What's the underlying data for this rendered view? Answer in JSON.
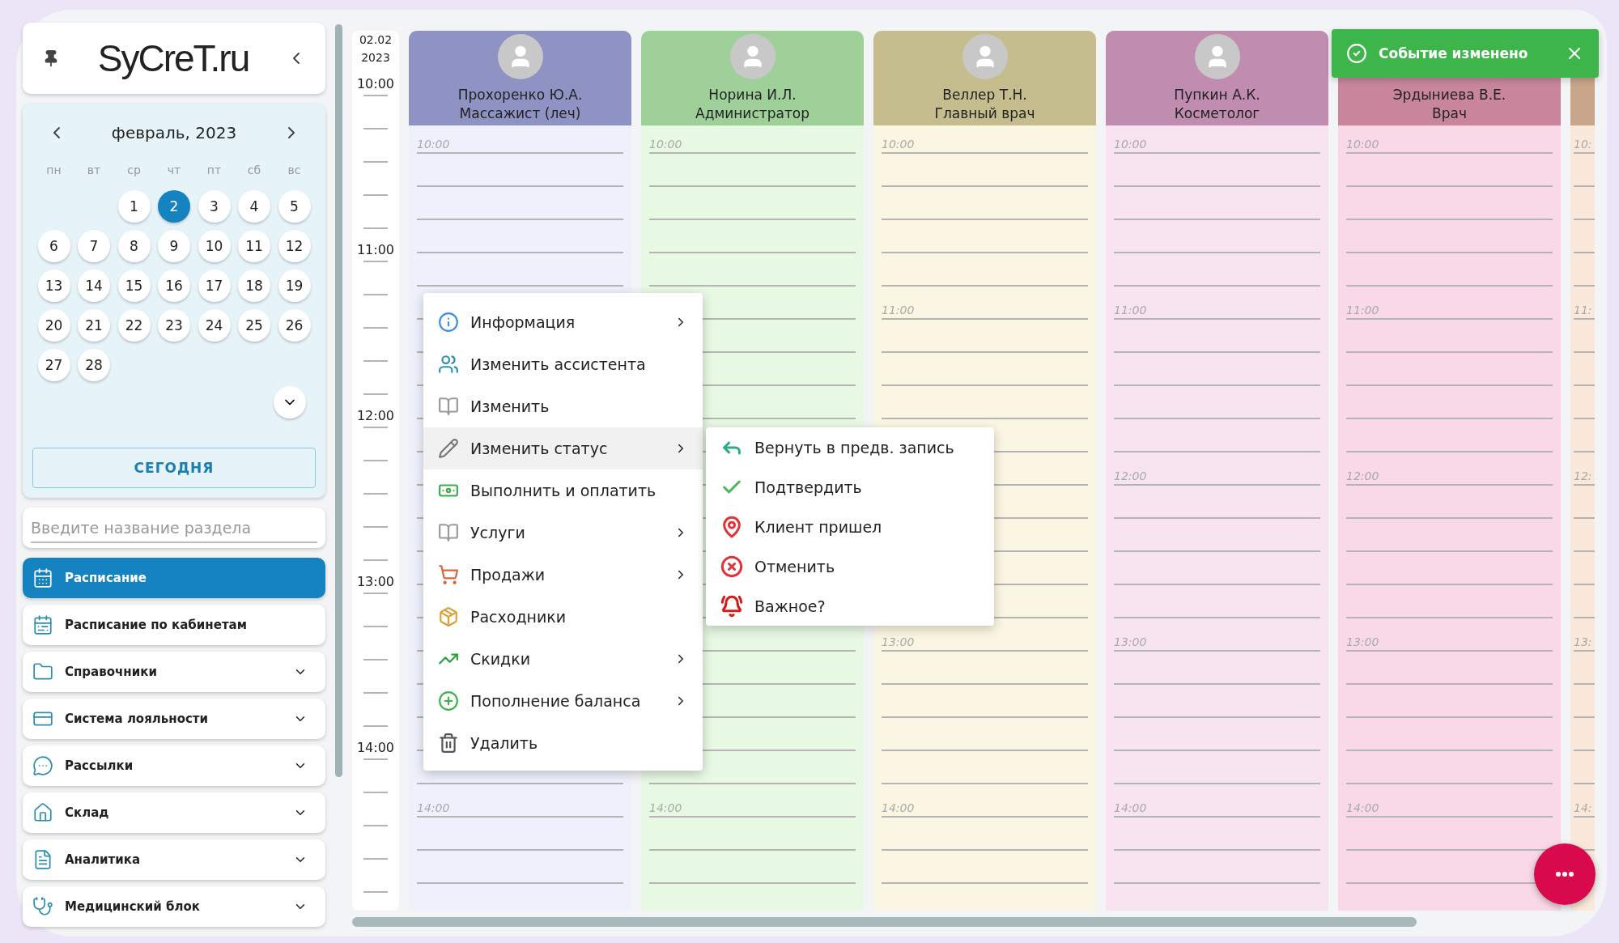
{
  "sidebar": {
    "logo": "SyCreT.ru",
    "calendar": {
      "month": "февраль, 2023",
      "weekdays": [
        "пн",
        "вт",
        "ср",
        "чт",
        "пт",
        "сб",
        "вс"
      ],
      "weeks": [
        {
          "kind": "leading",
          "days": [
            {
              "label": "1",
              "selected": false
            },
            {
              "label": "2",
              "selected": true
            },
            {
              "label": "3",
              "selected": false
            },
            {
              "label": "4",
              "selected": false
            },
            {
              "label": "5",
              "selected": false
            }
          ]
        },
        {
          "kind": "full",
          "days": [
            {
              "label": "6",
              "selected": false
            },
            {
              "label": "7",
              "selected": false
            },
            {
              "label": "8",
              "selected": false
            },
            {
              "label": "9",
              "selected": false
            },
            {
              "label": "10",
              "selected": false
            },
            {
              "label": "11",
              "selected": false
            },
            {
              "label": "12",
              "selected": false
            }
          ]
        },
        {
          "kind": "full",
          "days": [
            {
              "label": "13",
              "selected": false
            },
            {
              "label": "14",
              "selected": false
            },
            {
              "label": "15",
              "selected": false
            },
            {
              "label": "16",
              "selected": false
            },
            {
              "label": "17",
              "selected": false
            },
            {
              "label": "18",
              "selected": false
            },
            {
              "label": "19",
              "selected": false
            }
          ]
        },
        {
          "kind": "full",
          "days": [
            {
              "label": "20",
              "selected": false
            },
            {
              "label": "21",
              "selected": false
            },
            {
              "label": "22",
              "selected": false
            },
            {
              "label": "23",
              "selected": false
            },
            {
              "label": "24",
              "selected": false
            },
            {
              "label": "25",
              "selected": false
            },
            {
              "label": "26",
              "selected": false
            }
          ]
        },
        {
          "kind": "full",
          "days": [
            {
              "label": "27",
              "selected": false
            },
            {
              "label": "28",
              "selected": false
            }
          ]
        }
      ],
      "today_button": "СЕГОДНЯ"
    },
    "search": {
      "placeholder": "Введите название раздела"
    },
    "nav": [
      {
        "label": "Расписание",
        "selected": true,
        "expandable": false
      },
      {
        "label": "Расписание по кабинетам",
        "selected": false,
        "expandable": false
      },
      {
        "label": "Справочники",
        "selected": false,
        "expandable": true
      },
      {
        "label": "Система лояльности",
        "selected": false,
        "expandable": true
      },
      {
        "label": "Рассылки",
        "selected": false,
        "expandable": true
      },
      {
        "label": "Склад",
        "selected": false,
        "expandable": true
      },
      {
        "label": "Аналитика",
        "selected": false,
        "expandable": true
      },
      {
        "label": "Медицинский блок",
        "selected": false,
        "expandable": true
      }
    ]
  },
  "schedule": {
    "date": "02.02",
    "year": "2023",
    "hours": [
      "10:00",
      "11:00",
      "12:00",
      "13:00",
      "14:00"
    ],
    "columns": [
      {
        "kind": "staff",
        "avatar": true,
        "name": "Прохоренко Ю.А.",
        "role": "Массажист (леч)",
        "color": "#8e93c4",
        "blocks": [
          {
            "kind": "labeled",
            "label": "10:00"
          },
          {
            "kind": "blank"
          },
          {
            "kind": "blank"
          },
          {
            "kind": "blank"
          },
          {
            "kind": "labeled",
            "label": "14:00"
          }
        ]
      },
      {
        "kind": "staff",
        "avatar": true,
        "name": "Норина И.Л.",
        "role": "Администратор",
        "color": "#9fd09a",
        "blocks": [
          {
            "kind": "labeled",
            "label": "10:00"
          },
          {
            "kind": "blank"
          },
          {
            "kind": "blank"
          },
          {
            "kind": "blank"
          },
          {
            "kind": "labeled",
            "label": "14:00"
          }
        ]
      },
      {
        "kind": "staff",
        "avatar": true,
        "name": "Веллер Т.Н.",
        "role": "Главный врач",
        "color": "#c5bd8e",
        "blocks": [
          {
            "kind": "labeled",
            "label": "10:00"
          },
          {
            "kind": "labeled",
            "label": "11:00"
          },
          {
            "kind": "blank"
          },
          {
            "kind": "labeled",
            "label": "13:00"
          },
          {
            "kind": "labeled",
            "label": "14:00"
          }
        ]
      },
      {
        "kind": "staff",
        "avatar": true,
        "name": "Пупкин А.К.",
        "role": "Косметолог",
        "color": "#c08db0",
        "blocks": [
          {
            "kind": "labeled",
            "label": "10:00"
          },
          {
            "kind": "labeled",
            "label": "11:00"
          },
          {
            "kind": "labeled",
            "label": "12:00"
          },
          {
            "kind": "labeled",
            "label": "13:00"
          },
          {
            "kind": "labeled",
            "label": "14:00"
          }
        ]
      },
      {
        "kind": "staff",
        "avatar": false,
        "name": "Эрдыниева В.Е.",
        "role": "Врач",
        "color": "#c9859c",
        "blocks": [
          {
            "kind": "labeled",
            "label": "10:00"
          },
          {
            "kind": "labeled",
            "label": "11:00"
          },
          {
            "kind": "labeled",
            "label": "12:00"
          },
          {
            "kind": "labeled",
            "label": "13:00"
          },
          {
            "kind": "labeled",
            "label": "14:00"
          }
        ]
      },
      {
        "kind": "partial",
        "color": "#c9a58a",
        "blocks": [
          {
            "kind": "labeled",
            "label": "10:"
          },
          {
            "kind": "labeled",
            "label": "11:"
          },
          {
            "kind": "labeled",
            "label": "12:"
          },
          {
            "kind": "labeled",
            "label": "13:"
          },
          {
            "kind": "labeled",
            "label": "14:"
          }
        ]
      }
    ]
  },
  "context_menu": [
    {
      "label": "Информация",
      "submenu": true,
      "selected": false
    },
    {
      "label": "Изменить ассистента",
      "submenu": false,
      "selected": false
    },
    {
      "label": "Изменить",
      "submenu": false,
      "selected": false
    },
    {
      "label": "Изменить статус",
      "submenu": true,
      "selected": true
    },
    {
      "label": "Выполнить и оплатить",
      "submenu": false,
      "selected": false
    },
    {
      "label": "Услуги",
      "submenu": true,
      "selected": false
    },
    {
      "label": "Продажи",
      "submenu": true,
      "selected": false
    },
    {
      "label": "Расходники",
      "submenu": false,
      "selected": false
    },
    {
      "label": "Скидки",
      "submenu": true,
      "selected": false
    },
    {
      "label": "Пополнение баланса",
      "submenu": true,
      "selected": false
    },
    {
      "label": "Удалить",
      "submenu": false,
      "selected": false
    }
  ],
  "status_submenu": [
    "Вернуть в предв. запись",
    "Подтвердить",
    "Клиент пришел",
    "Отменить",
    "Важное?"
  ],
  "toast": {
    "message": "Событие изменено"
  }
}
